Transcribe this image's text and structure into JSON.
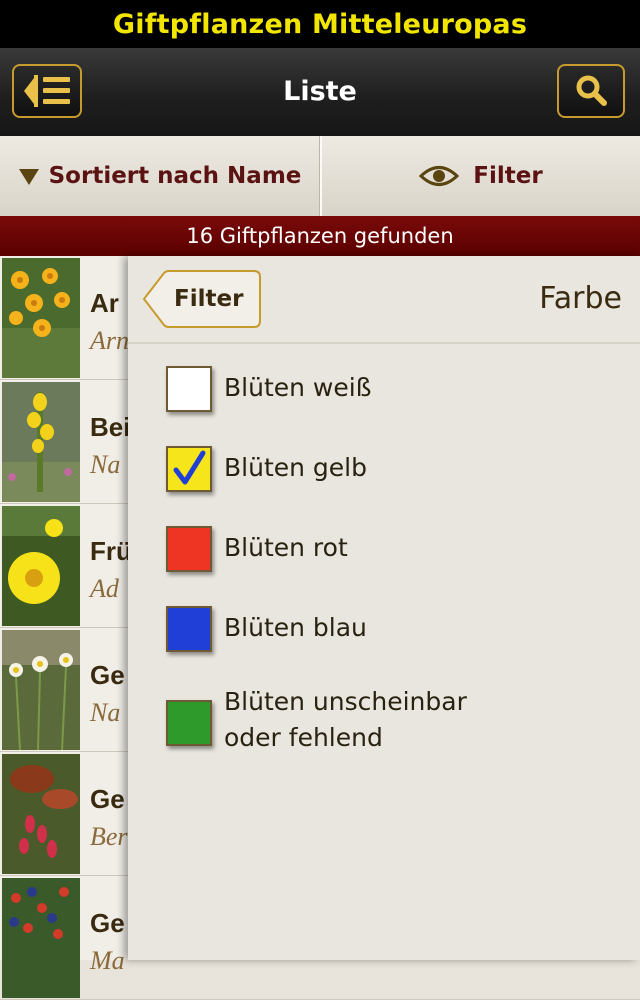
{
  "app": {
    "banner": "Giftpflanzen Mitteleuropas"
  },
  "nav": {
    "title": "Liste"
  },
  "toolbar": {
    "sort_label": "Sortiert nach Name",
    "filter_label": "Filter"
  },
  "results": {
    "count_text": "16 Giftpflanzen gefunden"
  },
  "list": {
    "items": [
      {
        "name": "Ar",
        "latin": "Arn"
      },
      {
        "name": "Bei",
        "latin": "Na"
      },
      {
        "name": "Frü",
        "latin": "Ad"
      },
      {
        "name": "Ge",
        "latin": "Na"
      },
      {
        "name": "Ge",
        "latin": "Ber"
      },
      {
        "name": "Ge",
        "latin": "Ma"
      }
    ]
  },
  "filter_panel": {
    "back_label": "Filter",
    "title": "Farbe",
    "options": [
      {
        "label": "Blüten weiß",
        "color": "#ffffff",
        "checked": false
      },
      {
        "label": "Blüten gelb",
        "color": "#f7e51b",
        "checked": true
      },
      {
        "label": "Blüten rot",
        "color": "#ee3524",
        "checked": false
      },
      {
        "label": "Blüten blau",
        "color": "#1f3fd6",
        "checked": false
      },
      {
        "label": "Blüten unscheinbar\noder fehlend",
        "color": "#2e9a2b",
        "checked": false
      }
    ]
  },
  "colors": {
    "accent_gold": "#c79a2e",
    "count_bar": "#6a0505",
    "label_brown": "#5a1212"
  }
}
